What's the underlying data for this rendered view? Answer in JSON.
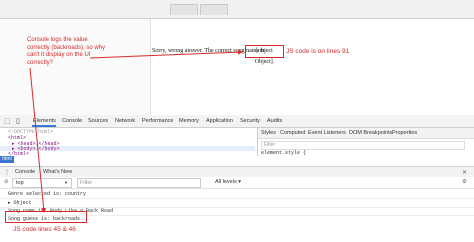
{
  "page": {
    "sentence": "Sorry, wrong answer. The correct song name",
    "sentence_suffix": "is",
    "object_text": "[object Object]."
  },
  "annotations": {
    "question": "Console logs the value correctly (backroads), so why can't it display on the UI correctly?",
    "js_lines_91": "JS code is on lines 91",
    "js_lines_45_46": "JS code lines 45 & 46"
  },
  "devtools": {
    "tabs": [
      "Elements",
      "Console",
      "Sources",
      "Network",
      "Performance",
      "Memory",
      "Application",
      "Security",
      "Audits"
    ],
    "active_tab": "Elements",
    "elements_lines": [
      "<!DOCTYPE html>",
      "<html>",
      "▸ <head>…</head>",
      "▸ <body>…</body>",
      "</html>"
    ],
    "breadcrumb": "html",
    "styles_tabs": [
      "Styles",
      "Computed",
      "Event Listeners",
      "DOM Breakpoints",
      "Properties"
    ],
    "styles_filter_placeholder": "Filter",
    "styles_rule": "element.style {",
    "accent_color": "#3879d9"
  },
  "console": {
    "drawer_label": "Console",
    "whats_new_label": "What's New",
    "context": "top",
    "filter_placeholder": "Filter",
    "levels": "All levels ▾",
    "logs": [
      "Genre selected is: country",
      "▸ Object",
      "Song name is: Body Like a Back Road",
      "Song guess is: backroads"
    ]
  },
  "colors": {
    "annotation_red": "#d62a2a"
  }
}
